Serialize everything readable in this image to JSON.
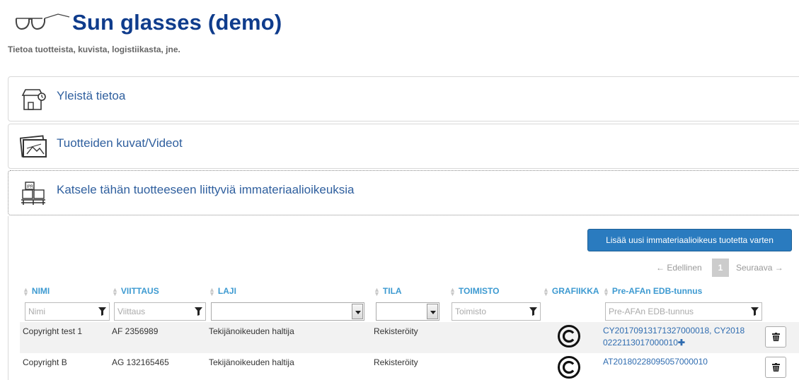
{
  "header": {
    "title": "Sun glasses (demo)",
    "subtitle": "Tietoa tuotteista, kuvista, logistiikasta, jne."
  },
  "panels": [
    {
      "title": "Yleistä tietoa",
      "icon": "box-icon"
    },
    {
      "title": "Tuotteiden kuvat/Videot",
      "icon": "photos-icon"
    },
    {
      "title": "Katsele tähän tuotteeseen liittyviä immateriaalioikeuksia",
      "icon": "ip-boxes-icon"
    }
  ],
  "actions": {
    "add_button": "Lisää uusi immateriaalioikeus tuotetta varten"
  },
  "pagination": {
    "prev": "← Edellinen",
    "current": "1",
    "next": "Seuraava →"
  },
  "table": {
    "columns": [
      "NIMI",
      "VIITTAUS",
      "LAJI",
      "TILA",
      "TOIMISTO",
      "GRAFIIKKA",
      "Pre-AFAn EDB-tunnus"
    ],
    "filters": {
      "nimi_placeholder": "Nimi",
      "viittaus_placeholder": "Viittaus",
      "toimisto_placeholder": "Toimisto",
      "edb_placeholder": "Pre-AFAn EDB-tunnus"
    },
    "rows": [
      {
        "nimi": "Copyright test 1",
        "viittaus": "AF 2356989",
        "laji": "Tekijänoikeuden haltija",
        "tila": "Rekisteröity",
        "toimisto": "",
        "grafiikka": "copyright-icon",
        "edb_line1": "CY20170913171327000018, CY2018",
        "edb_line2": "0222113017000010"
      },
      {
        "nimi": "Copyright B",
        "viittaus": "AG 132165465",
        "laji": "Tekijänoikeuden haltija",
        "tila": "Rekisteröity",
        "toimisto": "",
        "grafiikka": "copyright-icon",
        "edb_line1": "AT20180228095057000010",
        "edb_line2": ""
      }
    ]
  },
  "colors": {
    "title": "#0f3c8c",
    "link": "#2f5f9e",
    "header_text": "#3d9ad1",
    "button": "#2a7bbf"
  }
}
